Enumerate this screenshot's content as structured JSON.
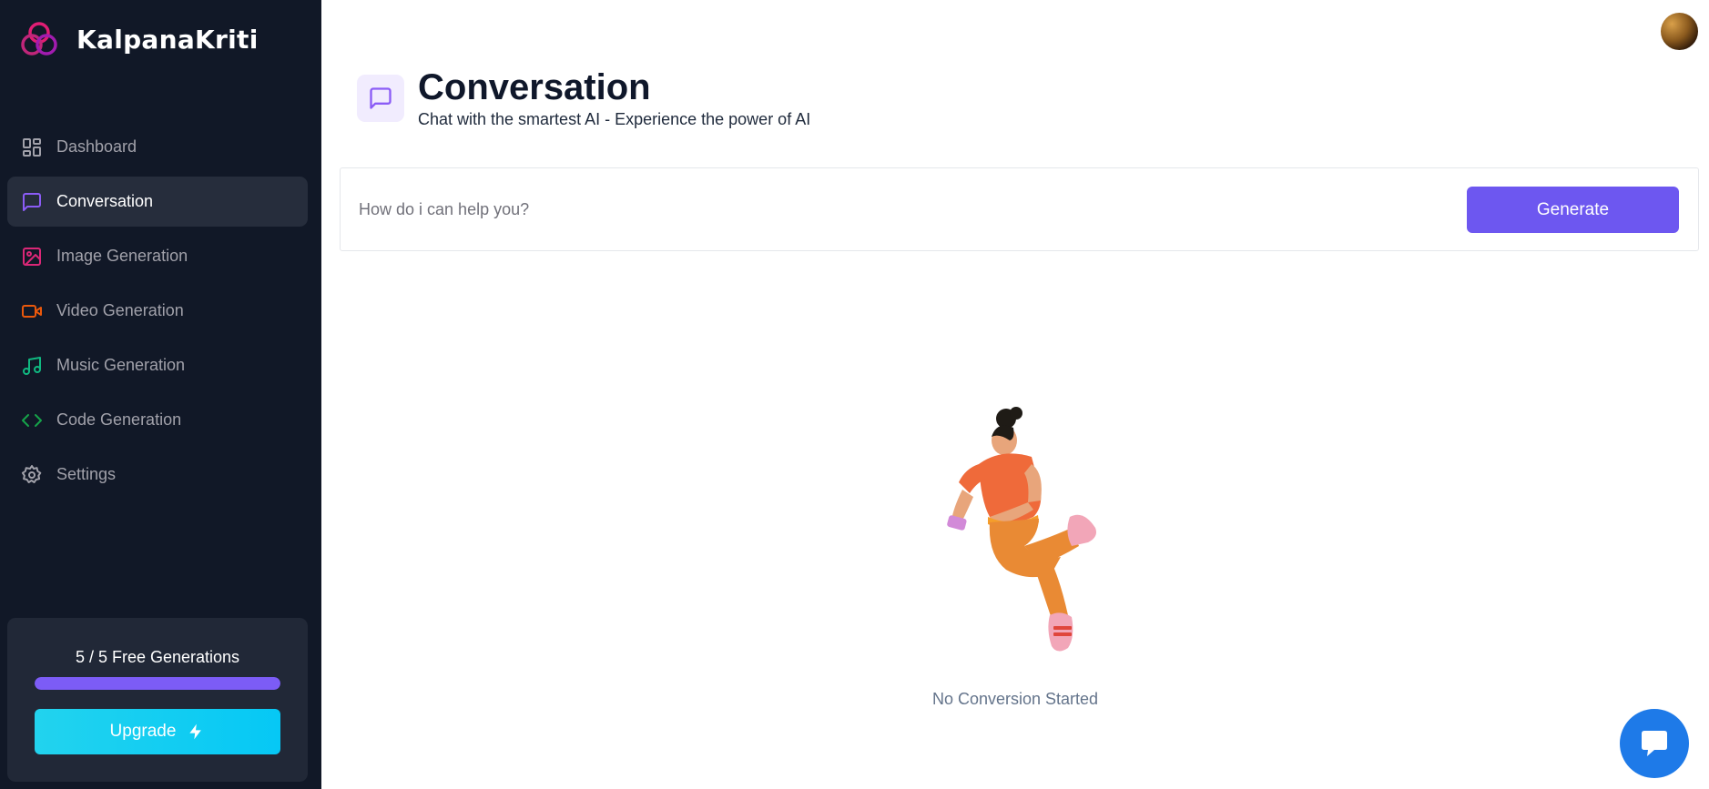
{
  "brand": {
    "name": "KalpanaKriti",
    "accent": "#e11d74"
  },
  "sidebar": {
    "items": [
      {
        "label": "Dashboard",
        "icon": "dashboard-icon",
        "color": "#a1a1aa",
        "active": false
      },
      {
        "label": "Conversation",
        "icon": "message-square-icon",
        "color": "#8b5cf6",
        "active": true
      },
      {
        "label": "Image Generation",
        "icon": "image-icon",
        "color": "#db2777",
        "active": false
      },
      {
        "label": "Video Generation",
        "icon": "video-icon",
        "color": "#ea580c",
        "active": false
      },
      {
        "label": "Music Generation",
        "icon": "music-icon",
        "color": "#10b981",
        "active": false
      },
      {
        "label": "Code Generation",
        "icon": "code-icon",
        "color": "#16a34a",
        "active": false
      },
      {
        "label": "Settings",
        "icon": "settings-gear-icon",
        "color": "#a1a1aa",
        "active": false
      }
    ]
  },
  "credits": {
    "text": "5 / 5 Free Generations",
    "used": 5,
    "limit": 5,
    "progress_fraction": 1.0,
    "upgrade_label": "Upgrade",
    "upgrade_icon": "zap-icon"
  },
  "header": {
    "title": "Conversation",
    "subtitle": "Chat with the smartest AI - Experience the power of AI",
    "icon": "message-square-icon",
    "icon_color": "#8b5cf6"
  },
  "prompt": {
    "placeholder": "How do i can help you?",
    "value": "",
    "button_label": "Generate",
    "button_color": "#6d57f0"
  },
  "empty_state": {
    "text": "No Conversion Started",
    "illustration": "person-with-phone-illustration"
  },
  "chat_widget": {
    "icon": "chat-bubble-icon",
    "color": "#1e7ae8"
  }
}
